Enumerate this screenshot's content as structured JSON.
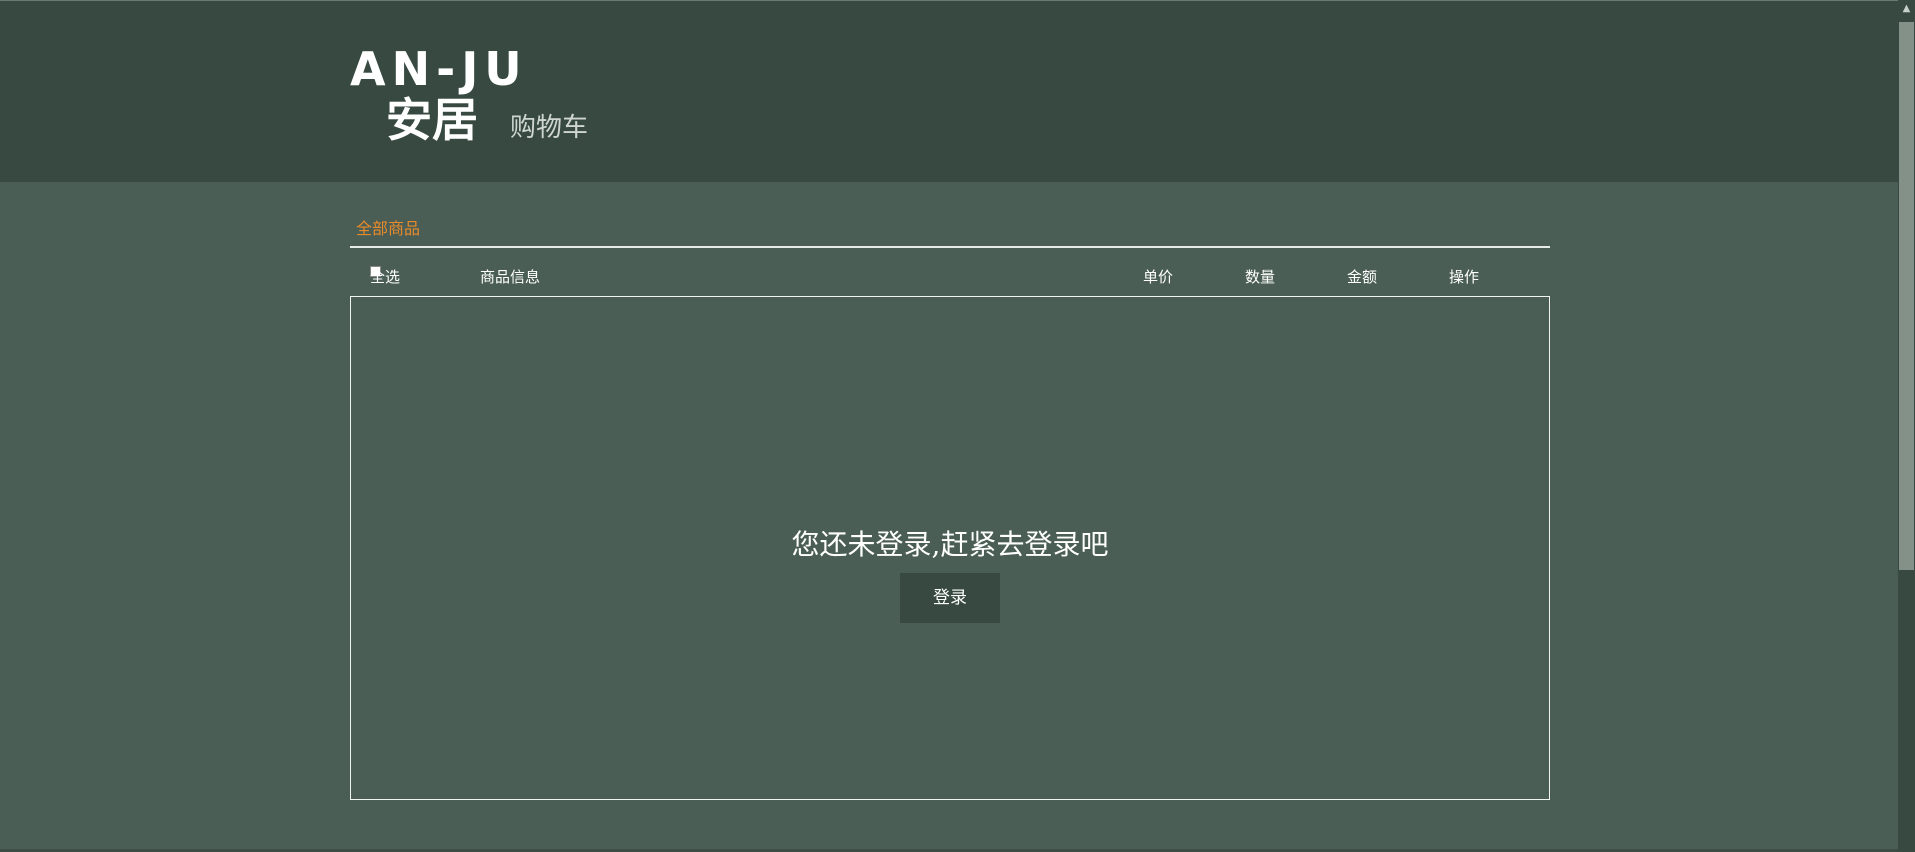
{
  "header": {
    "logo_en": "AN-JU",
    "logo_cn": "安居",
    "subtitle": "购物车",
    "background_color": "#374941"
  },
  "tabs": {
    "all_products": "全部商品",
    "active_color": "#e78b2a"
  },
  "table_header": {
    "select_all": "全选",
    "product_info": "商品信息",
    "unit_price": "单价",
    "quantity": "数量",
    "amount": "金额",
    "operation": "操作"
  },
  "cart": {
    "empty_message": "您还未登录,赶紧去登录吧",
    "login_button": "登录"
  },
  "icons": {
    "scroll_up": "scroll-up-arrow-icon",
    "checkbox": "checkbox-icon"
  }
}
